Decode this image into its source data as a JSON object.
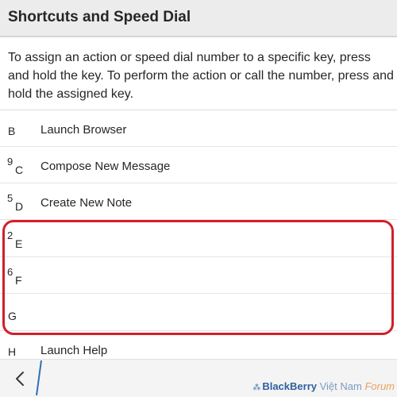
{
  "header": {
    "title": "Shortcuts and Speed Dial"
  },
  "instructions": "To assign an action or speed dial number to a specific key, press and hold the key. To perform the action or call the number, press and hold the assigned key.",
  "shortcuts": [
    {
      "key": "B",
      "number": "",
      "action": "Launch Browser"
    },
    {
      "key": "C",
      "number": "9",
      "action": "Compose New Message"
    },
    {
      "key": "D",
      "number": "5",
      "action": "Create New Note"
    },
    {
      "key": "E",
      "number": "2",
      "action": ""
    },
    {
      "key": "F",
      "number": "6",
      "action": ""
    },
    {
      "key": "G",
      "number": "",
      "action": ""
    },
    {
      "key": "H",
      "number": "",
      "action": "Launch Help"
    }
  ],
  "footer": {
    "watermark_brand": "BlackBerry",
    "watermark_region": " Việt Nam ",
    "watermark_suffix": "Forum"
  },
  "colors": {
    "highlight": "#d0202b",
    "header_bg": "#ececec",
    "accent_blue": "#2f6fb5"
  },
  "icons": {
    "back": "chevron-left-icon",
    "brand": "blackberry-logo-icon"
  }
}
